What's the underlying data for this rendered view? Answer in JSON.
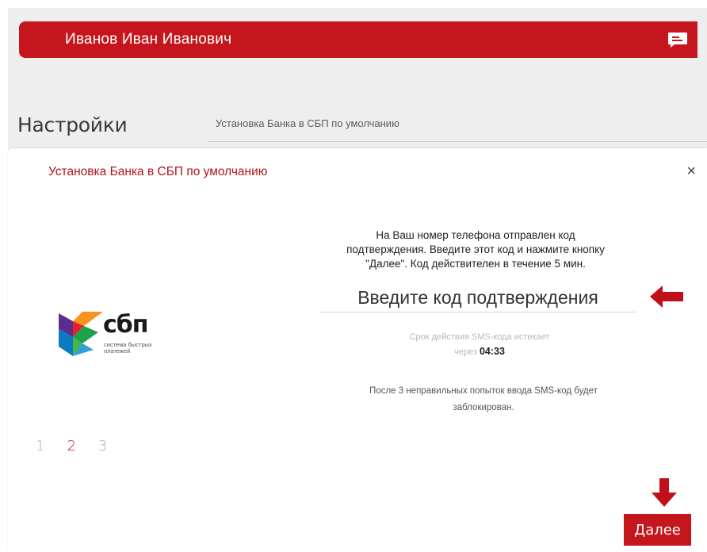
{
  "header": {
    "user_name": "Иванов Иван Иванович",
    "chat_icon": "chat-icon"
  },
  "page": {
    "title": "Настройки",
    "breadcrumb": "Установка Банка в СБП по умолчанию"
  },
  "dialog": {
    "title": "Установка Банка в СБП по умолчанию",
    "close_label": "×",
    "logo": {
      "name": "сбп",
      "tagline_line1": "система быстрых",
      "tagline_line2": "платежей"
    },
    "info_line1": "На Ваш номер телефона отправлен код",
    "info_line2": "подтверждения. Введите этот код и нажмите кнопку",
    "info_line3": "\"Далее\". Код действителен в течение 5 мин.",
    "code_placeholder": "Введите код подтверждения",
    "timer_label_line1": "Срок действия SMS-кода истекает",
    "timer_label_line2": "через",
    "timer_value": "04:33",
    "warning_line1": "После 3 неправильных попыток ввода SMS-код будет",
    "warning_line2": "заблокирован.",
    "steps": [
      "1",
      "2",
      "3"
    ],
    "active_step": "2",
    "next_label": "Далее"
  },
  "colors": {
    "accent": "#c5161d",
    "annotation_arrow": "#c0111a"
  }
}
